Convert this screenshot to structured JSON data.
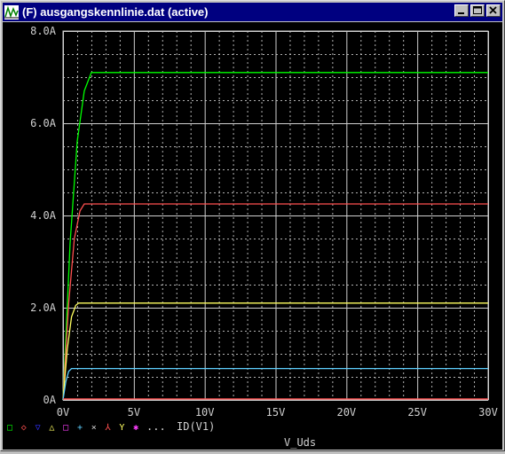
{
  "window": {
    "title": "(F) ausgangskennlinie.dat (active)",
    "title_icon": "probe-waveform-icon",
    "buttons": [
      "minimize-icon",
      "maximize-icon",
      "close-icon"
    ]
  },
  "colors": {
    "background": "#000000",
    "grid": "#d0d0d0",
    "axis_text": "#d0d0d0",
    "series": [
      "#00ff00",
      "#ff5050",
      "#ffff60",
      "#5fd0ff",
      "#ff5050"
    ]
  },
  "legend": {
    "symbols": [
      {
        "glyph": "□",
        "color": "#00ff00"
      },
      {
        "glyph": "◇",
        "color": "#ff5050"
      },
      {
        "glyph": "▽",
        "color": "#3030ff"
      },
      {
        "glyph": "△",
        "color": "#ffff60"
      },
      {
        "glyph": "□",
        "color": "#ff40ff"
      },
      {
        "glyph": "+",
        "color": "#5fd0ff"
      },
      {
        "glyph": "×",
        "color": "#d0d0d0"
      },
      {
        "glyph": "⅄",
        "color": "#ff5050"
      },
      {
        "glyph": "Y",
        "color": "#ffff60"
      },
      {
        "glyph": "✱",
        "color": "#ff40ff"
      }
    ],
    "ellipsis": "...",
    "trace_name": "ID(V1)"
  },
  "chart_data": {
    "type": "line",
    "xlabel": "V_Uds",
    "ylabel": "",
    "xlim": [
      0,
      30
    ],
    "ylim": [
      0,
      8
    ],
    "x_ticks": [
      "0V",
      "5V",
      "10V",
      "15V",
      "20V",
      "25V",
      "30V"
    ],
    "y_ticks": [
      "0A",
      "2.0A",
      "4.0A",
      "6.0A",
      "8.0A"
    ],
    "grid": true,
    "series": [
      {
        "x": [
          0,
          0.5,
          1,
          1.5,
          2,
          30
        ],
        "values": [
          0,
          3.4,
          5.6,
          6.7,
          7.1,
          7.1
        ]
      },
      {
        "x": [
          0,
          0.4,
          0.8,
          1.2,
          1.5,
          30
        ],
        "values": [
          0,
          2.1,
          3.5,
          4.1,
          4.25,
          4.25
        ]
      },
      {
        "x": [
          0,
          0.3,
          0.6,
          0.9,
          1.1,
          30
        ],
        "values": [
          0,
          1.1,
          1.8,
          2.05,
          2.1,
          2.1
        ]
      },
      {
        "x": [
          0,
          0.2,
          0.4,
          0.6,
          30
        ],
        "values": [
          0,
          0.4,
          0.62,
          0.68,
          0.68
        ]
      },
      {
        "x": [
          0,
          30
        ],
        "values": [
          0.02,
          0.02
        ]
      }
    ]
  }
}
